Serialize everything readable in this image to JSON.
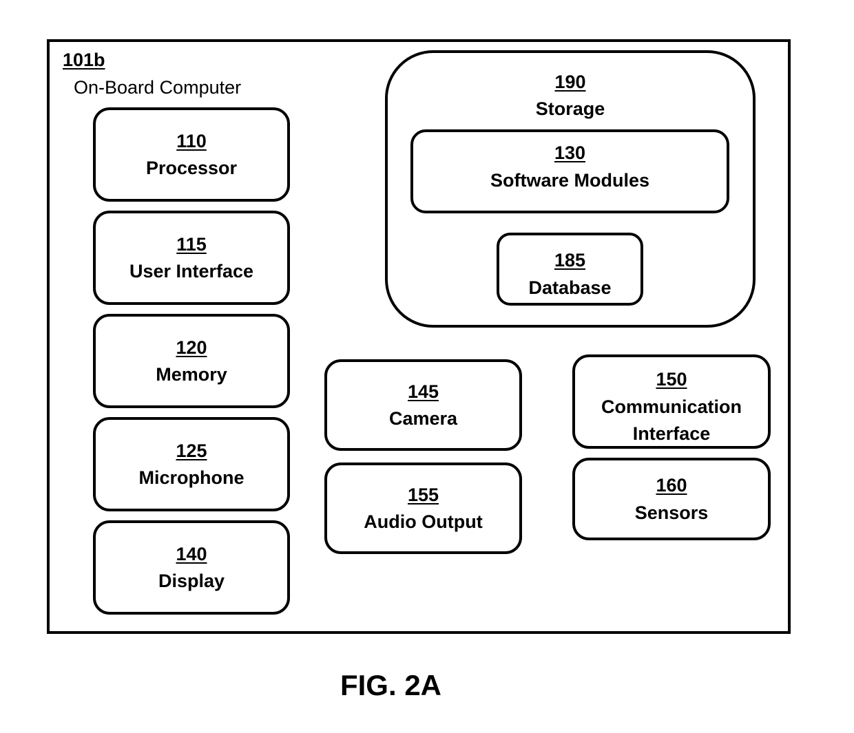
{
  "diagram": {
    "outer": {
      "number": "101b",
      "name": "On-Board Computer"
    },
    "left_column": [
      {
        "number": "110",
        "name": "Processor"
      },
      {
        "number": "115",
        "name": "User Interface"
      },
      {
        "number": "120",
        "name": "Memory"
      },
      {
        "number": "125",
        "name": "Microphone"
      },
      {
        "number": "140",
        "name": "Display"
      }
    ],
    "storage": {
      "number": "190",
      "name": "Storage",
      "software": {
        "number": "130",
        "name": "Software Modules"
      },
      "database": {
        "number": "185",
        "name": "Database"
      }
    },
    "middle_column": [
      {
        "number": "145",
        "name": "Camera"
      },
      {
        "number": "155",
        "name": "Audio Output"
      }
    ],
    "right_column": [
      {
        "number": "150",
        "name": "Communication Interface"
      },
      {
        "number": "160",
        "name": "Sensors"
      }
    ]
  },
  "caption": "FIG. 2A"
}
